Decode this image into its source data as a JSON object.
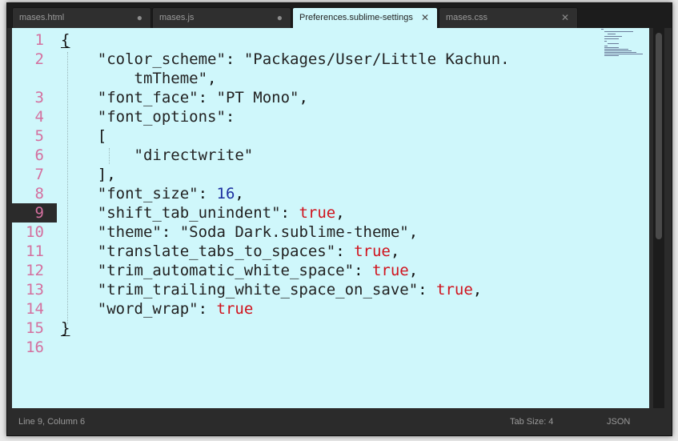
{
  "tabs": [
    {
      "label": "mases.html",
      "marker": "●",
      "active": false
    },
    {
      "label": "mases.js",
      "marker": "●",
      "active": false
    },
    {
      "label": "Preferences.sublime-settings",
      "marker": "✕",
      "active": true
    },
    {
      "label": "mases.css",
      "marker": "✕",
      "active": false
    }
  ],
  "gutter": [
    "1",
    "2",
    "",
    "3",
    "4",
    "5",
    "6",
    "7",
    "8",
    "9",
    "10",
    "11",
    "12",
    "13",
    "14",
    "15",
    "16"
  ],
  "current_line": "9",
  "code": {
    "open_brace": "{",
    "color_scheme_key": "\"color_scheme\"",
    "color_scheme_val_a": "\"Packages/User/Little Kachun.",
    "color_scheme_val_b": "tmTheme\"",
    "font_face_key": "\"font_face\"",
    "font_face_val": "\"PT Mono\"",
    "font_options_key": "\"font_options\"",
    "bracket_open": "[",
    "directwrite": "\"directwrite\"",
    "bracket_close": "]",
    "font_size_key": "\"font_size\"",
    "font_size_val": "16",
    "shift_tab_key": "\"shift_tab_unindent\"",
    "theme_key": "\"theme\"",
    "theme_val": "\"Soda Dark.sublime-theme\"",
    "translate_key": "\"translate_tabs_to_spaces\"",
    "trim_auto_key": "\"trim_automatic_white_space\"",
    "trim_trailing_key": "\"trim_trailing_white_space_on_save\"",
    "word_wrap_key": "\"word_wrap\"",
    "true_val": "true",
    "close_brace": "}"
  },
  "status": {
    "position": "Line 9, Column 6",
    "tab_size": "Tab Size: 4",
    "syntax": "JSON"
  },
  "colors": {
    "editor_bg": "#cff7fb",
    "line_number": "#d4709f",
    "boolean": "#d0121c",
    "number": "#1c2fa0"
  }
}
